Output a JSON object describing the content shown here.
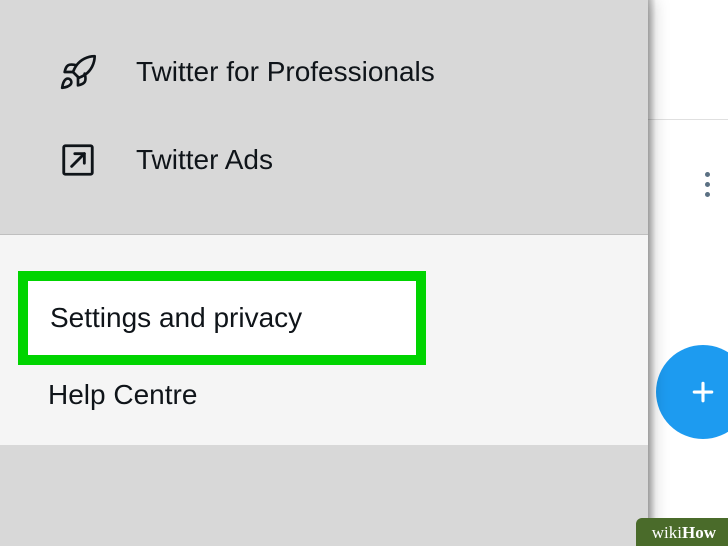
{
  "menu": {
    "professionals": {
      "label": "Twitter for Professionals"
    },
    "ads": {
      "label": "Twitter Ads"
    },
    "settings": {
      "label": "Settings and privacy"
    },
    "help": {
      "label": "Help Centre"
    }
  },
  "watermark": {
    "wiki": "wiki",
    "how": "How"
  }
}
